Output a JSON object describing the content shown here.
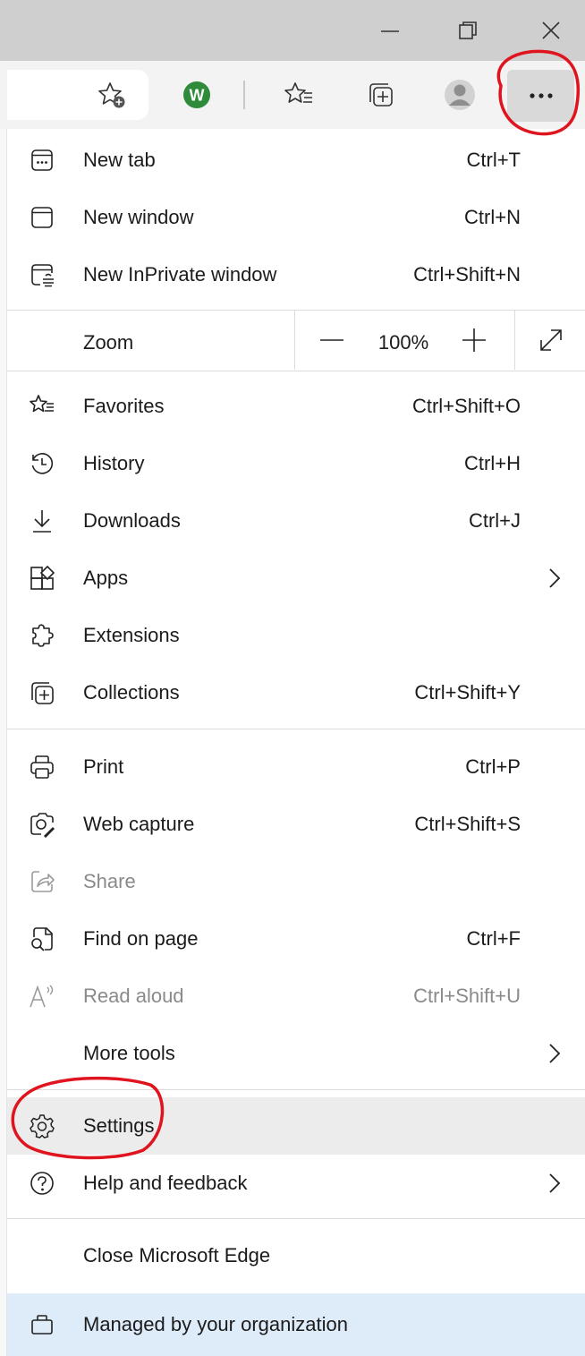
{
  "menu": {
    "new_tab": {
      "label": "New tab",
      "shortcut": "Ctrl+T"
    },
    "new_window": {
      "label": "New window",
      "shortcut": "Ctrl+N"
    },
    "new_inprivate": {
      "label": "New InPrivate window",
      "shortcut": "Ctrl+Shift+N"
    },
    "zoom": {
      "label": "Zoom",
      "value": "100%",
      "minus": "—",
      "plus": "+"
    },
    "favorites": {
      "label": "Favorites",
      "shortcut": "Ctrl+Shift+O"
    },
    "history": {
      "label": "History",
      "shortcut": "Ctrl+H"
    },
    "downloads": {
      "label": "Downloads",
      "shortcut": "Ctrl+J"
    },
    "apps": {
      "label": "Apps"
    },
    "extensions": {
      "label": "Extensions"
    },
    "collections": {
      "label": "Collections",
      "shortcut": "Ctrl+Shift+Y"
    },
    "print": {
      "label": "Print",
      "shortcut": "Ctrl+P"
    },
    "web_capture": {
      "label": "Web capture",
      "shortcut": "Ctrl+Shift+S"
    },
    "share": {
      "label": "Share"
    },
    "find_on_page": {
      "label": "Find on page",
      "shortcut": "Ctrl+F"
    },
    "read_aloud": {
      "label": "Read aloud",
      "shortcut": "Ctrl+Shift+U"
    },
    "more_tools": {
      "label": "More tools"
    },
    "settings": {
      "label": "Settings"
    },
    "help": {
      "label": "Help and feedback"
    },
    "close_edge": {
      "label": "Close Microsoft Edge"
    },
    "managed": {
      "label": "Managed by your organization"
    }
  },
  "toolbar": {
    "extension_letter": "W",
    "more_label": "..."
  },
  "colors": {
    "extension_green": "#2e8b3a",
    "annotation_red": "#e0141e",
    "managed_bg": "#deebf8",
    "settings_highlight": "#ececec"
  }
}
